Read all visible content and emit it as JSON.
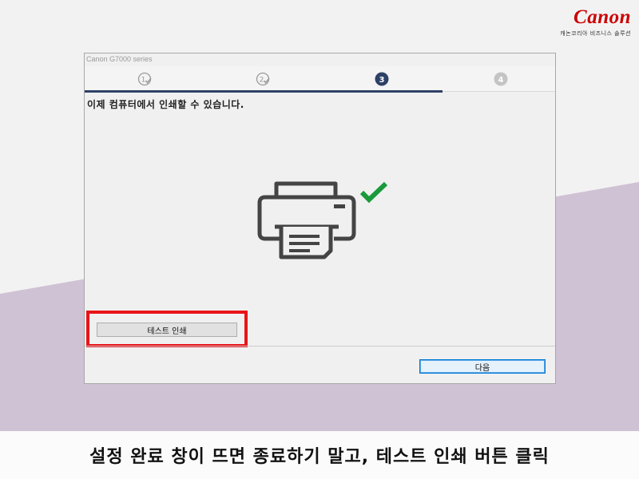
{
  "brand": {
    "logo": "Canon",
    "tagline": "캐논코리아 비즈니스 솔루션",
    "color": "#cc0000"
  },
  "window": {
    "title": "Canon G7000 series",
    "steps": [
      {
        "label": "1",
        "state": "done"
      },
      {
        "label": "2",
        "state": "done"
      },
      {
        "label": "3",
        "state": "current"
      },
      {
        "label": "4",
        "state": "pending"
      }
    ],
    "progress_fraction": 0.76,
    "message": "이제 컴퓨터에서 인쇄할 수 있습니다.",
    "test_print_button": "테스트 인쇄",
    "next_button": "다음",
    "illustration_icon": "printer-icon",
    "check_icon": "check-icon",
    "check_color": "#1a9a3a",
    "accent_color": "#2e4166",
    "highlight_color": "#e8141a"
  },
  "caption": "설정 완료 창이 뜨면 종료하기 말고, 테스트 인쇄 버튼 클릭"
}
